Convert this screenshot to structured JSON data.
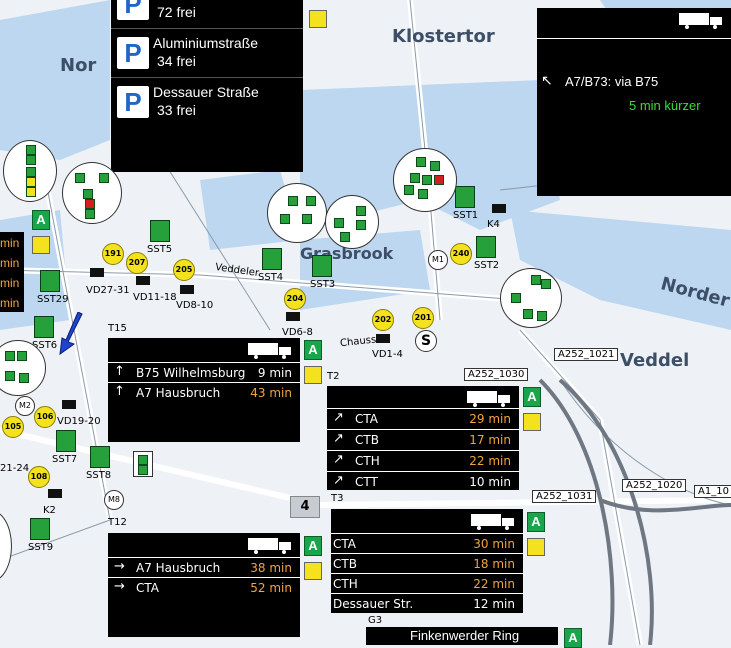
{
  "parking": [
    {
      "name": "",
      "free": "72 frei"
    },
    {
      "name": "Aluminiumstraße",
      "free": "34 frei"
    },
    {
      "name": "Dessauer Straße",
      "free": "33 frei"
    }
  ],
  "parking_icon": "P",
  "panel_truck_right": {
    "route": "A7/B73: via B75",
    "note": "5 min kürzer"
  },
  "panel_t15": {
    "rows": [
      {
        "dest": "B75 Wilhelmsburg",
        "time": "9 min"
      },
      {
        "dest": "A7 Hausbruch",
        "time": "43 min"
      }
    ]
  },
  "panel_t2": {
    "rows": [
      {
        "dest": "CTA",
        "time": "29 min"
      },
      {
        "dest": "CTB",
        "time": "17 min"
      },
      {
        "dest": "CTH",
        "time": "22 min"
      },
      {
        "dest": "CTT",
        "time": "10 min"
      }
    ]
  },
  "panel_t12": {
    "rows": [
      {
        "dest": "A7 Hausbruch",
        "time": "38 min"
      },
      {
        "dest": "CTA",
        "time": "52 min"
      }
    ]
  },
  "panel_t3": {
    "rows": [
      {
        "dest": "CTA",
        "time": "30 min"
      },
      {
        "dest": "CTB",
        "time": "18 min"
      },
      {
        "dest": "CTH",
        "time": "22 min"
      },
      {
        "dest": "Dessauer Str.",
        "time": "12 min"
      }
    ]
  },
  "bottom_bar": "Finkenwerder Ring",
  "map_labels": {
    "klostertor": "Klostertor",
    "veddel": "Veddel",
    "grasbrook": "Grasbrook",
    "norder": "Norder",
    "nord": "Nor",
    "veddeler": "Veddeler",
    "chausse": "Chausse",
    "t15": "T15",
    "t2": "T2",
    "t3": "T3",
    "t12": "T12",
    "k2": "K2",
    "k4": "K4",
    "g3": "G3",
    "m2": "M2",
    "m8": "M8",
    "m1": "M1",
    "shield4": "4"
  },
  "detectors": {
    "vd27": "VD27-31",
    "vd11": "VD11-18",
    "vd8": "VD8-10",
    "vd6": "VD6-8",
    "vd1": "VD1-4",
    "vd19": "VD19-20",
    "vd21": "21-24"
  },
  "stations": {
    "sst5": "SST5",
    "sst4": "SST4",
    "sst3": "SST3",
    "sst1": "SST1",
    "sst2": "SST2",
    "sst29": "SST29",
    "sst6": "SST6",
    "sst7": "SST7",
    "sst8": "SST8",
    "sst9": "SST9"
  },
  "yellow_markers": {
    "m191": "191",
    "m207": "207",
    "m205": "205",
    "m204": "204",
    "m202": "202",
    "m201": "201",
    "m240": "240",
    "m106": "106",
    "m105": "105",
    "m108": "108"
  },
  "road_labels": {
    "a252_1021": "A252_1021",
    "a252_1030": "A252_1030",
    "a252_1031": "A252_1031",
    "a252_1020": "A252_1020",
    "a1_10": "A1_10"
  },
  "left_partial_times": [
    "min",
    "min",
    "min",
    "min"
  ],
  "colors": {
    "water": "#bcd7ef",
    "land": "#eef2f6",
    "sign_green": "#25a03b",
    "time_orange": "#f4a340",
    "note_green": "#3bdd3b"
  }
}
